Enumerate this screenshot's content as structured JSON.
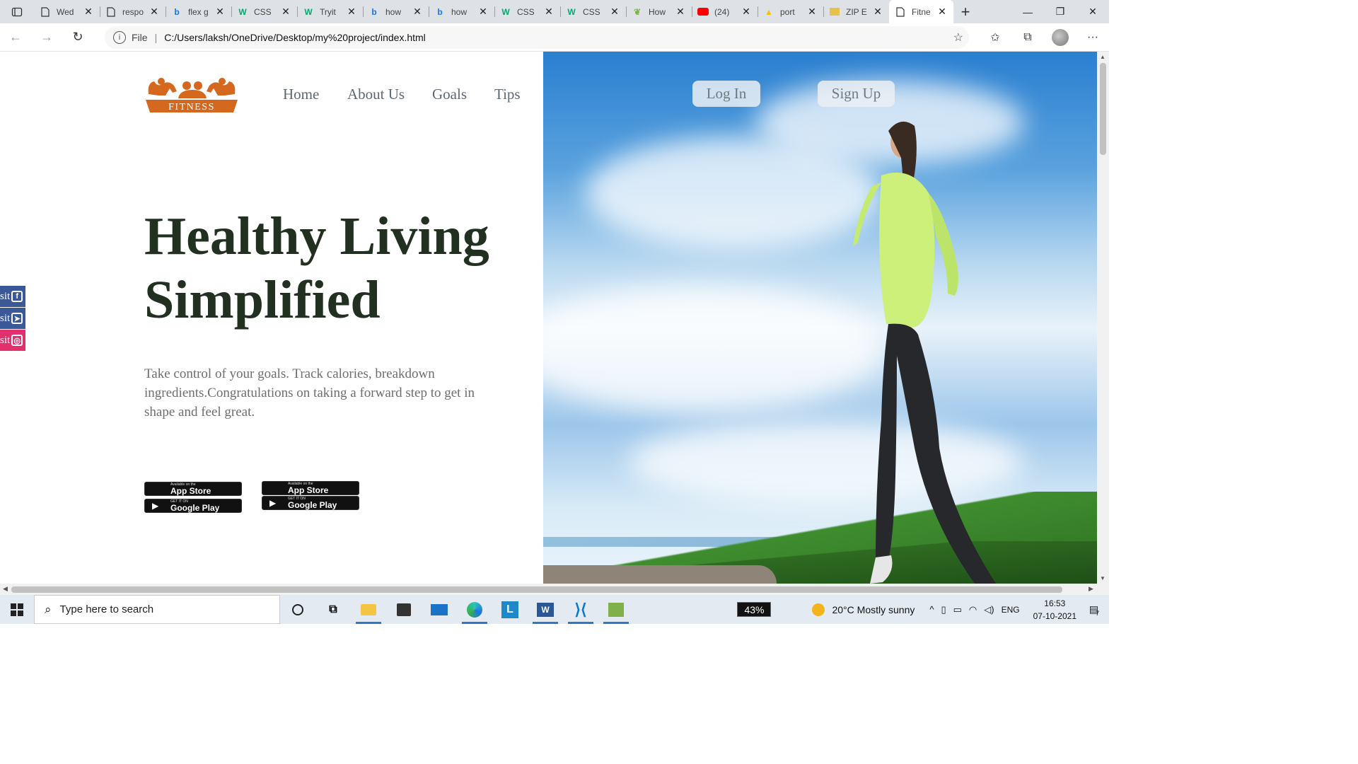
{
  "browser": {
    "tabs": [
      {
        "title": "Wed",
        "icon": "page-icon"
      },
      {
        "title": "respo",
        "icon": "page-icon"
      },
      {
        "title": "flex g",
        "icon": "bing-icon"
      },
      {
        "title": "CSS",
        "icon": "w3schools-icon"
      },
      {
        "title": "Tryit",
        "icon": "w3schools-icon"
      },
      {
        "title": "how",
        "icon": "bing-icon"
      },
      {
        "title": "how",
        "icon": "bing-icon"
      },
      {
        "title": "CSS",
        "icon": "w3schools-icon"
      },
      {
        "title": "CSS",
        "icon": "w3schools-icon"
      },
      {
        "title": "How",
        "icon": "leaf-icon"
      },
      {
        "title": "(24)",
        "icon": "youtube-icon"
      },
      {
        "title": "port",
        "icon": "google-drive-icon"
      },
      {
        "title": "ZIP E",
        "icon": "zip-folder-icon"
      },
      {
        "title": "Fitne",
        "icon": "page-icon",
        "active": true
      }
    ],
    "address": {
      "scheme_label": "File",
      "url": "C:/Users/laksh/OneDrive/Desktop/my%20project/index.html"
    }
  },
  "page": {
    "logo_text": "FITNESS",
    "menu": [
      "Home",
      "About Us",
      "Goals",
      "Tips"
    ],
    "auth": {
      "login": "Log In",
      "signup": "Sign Up"
    },
    "headline": [
      "Healthy Living",
      "Simplified"
    ],
    "lead": "Take control of your goals. Track calories, breakdown ingredients.Congratulations on taking a forward step to get in shape and feel great.",
    "badges": [
      {
        "small": "Available on the",
        "large": "App Store",
        "icon": "apple-icon"
      },
      {
        "small": "GET IT ON",
        "large": "Google Play",
        "icon": "play-icon"
      },
      {
        "small": "Available on the",
        "large": "App Store",
        "icon": "apple-icon"
      },
      {
        "small": "GET IT ON",
        "large": "Google Play",
        "icon": "play-icon"
      }
    ],
    "social": [
      {
        "text": "sit",
        "icon": "facebook-icon",
        "glyph": "f",
        "color": "#3b5998"
      },
      {
        "text": "sit",
        "icon": "telegram-icon",
        "glyph": "➤",
        "color": "#3b5998"
      },
      {
        "text": "sit",
        "icon": "instagram-icon",
        "glyph": "◎",
        "color": "#e1306c"
      }
    ]
  },
  "taskbar": {
    "search_placeholder": "Type here to search",
    "battery": "43%",
    "weather": "20°C  Mostly sunny",
    "lang": "ENG",
    "time": "16:53",
    "date": "07-10-2021",
    "notifications": "7"
  }
}
